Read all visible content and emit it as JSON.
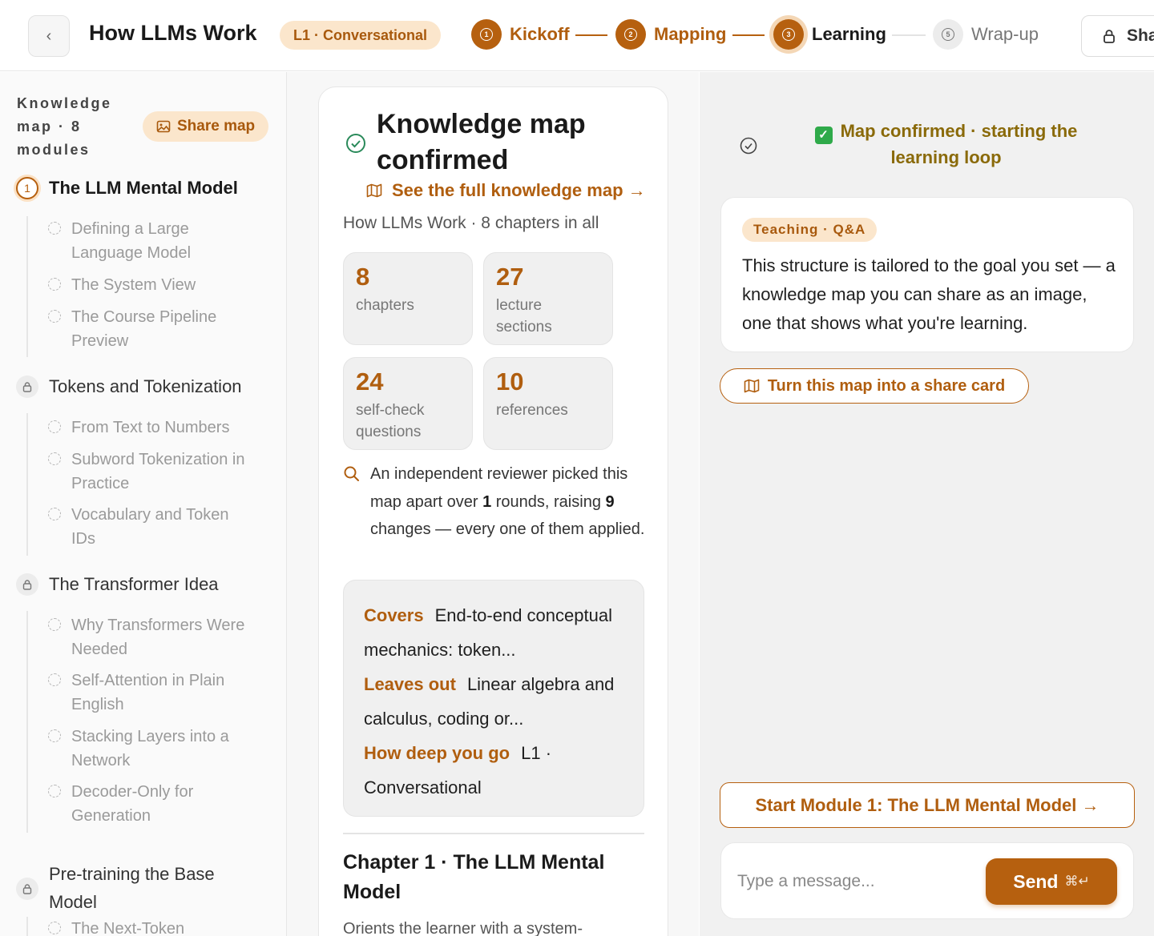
{
  "header": {
    "back_icon": "‹",
    "title": "How LLMs Work",
    "level_badge": "L1 · Conversational",
    "steps": [
      {
        "num": "1",
        "label": "Kickoff",
        "state": "done"
      },
      {
        "num": "2",
        "label": "Mapping",
        "state": "done"
      },
      {
        "num": "3",
        "label": "Learning",
        "state": "active"
      },
      {
        "num": "5",
        "label": "Wrap-up",
        "state": "todo"
      }
    ],
    "share_label": "Sha"
  },
  "sidebar": {
    "title": "Knowledge map · 8 modules",
    "share_map_label": "Share map",
    "modules": [
      {
        "index": "1",
        "label": "The LLM Mental Model",
        "state": "active",
        "lessons": [
          "Defining a Large Language Model",
          "The System View",
          "The Course Pipeline Preview"
        ]
      },
      {
        "index": "",
        "label": "Tokens and Tokenization",
        "state": "locked",
        "lessons": [
          "From Text to Numbers",
          "Subword Tokenization in Practice",
          "Vocabulary and Token IDs"
        ]
      },
      {
        "index": "",
        "label": "The Transformer Idea",
        "state": "locked",
        "lessons": [
          "Why Transformers Were Needed",
          "Self-Attention in Plain English",
          "Stacking Layers into a Network",
          "Decoder-Only for Generation"
        ]
      },
      {
        "index": "",
        "label": "Pre-training the Base Model",
        "state": "locked",
        "lessons": [
          "The Next-Token"
        ]
      }
    ]
  },
  "center": {
    "title": "Knowledge map confirmed",
    "map_link": "See the full knowledge map →",
    "subtitle": "How LLMs Work · 8 chapters in all",
    "stats": [
      {
        "value": "8",
        "label": "chapters"
      },
      {
        "value": "27",
        "label": "lecture sections"
      },
      {
        "value": "24",
        "label": "self-check questions"
      },
      {
        "value": "10",
        "label": "references"
      }
    ],
    "review": {
      "p1": "An independent reviewer picked this map apart over ",
      "rounds": "1",
      "p2": " rounds, raising ",
      "changes": "9",
      "p3": " changes — every one of them applied."
    },
    "covers": {
      "covers_key": "Covers",
      "covers_val": "End-to-end conceptual mechanics: token...",
      "leaves_key": "Leaves out",
      "leaves_val": "Linear algebra and calculus, coding or...",
      "deep_key": "How deep you go",
      "deep_val": "L1 · Conversational"
    },
    "chapter_title": "Chapter 1 · The LLM Mental Model",
    "chapter_desc": "Orients the learner with a system-"
  },
  "right": {
    "status_emoji": "✓",
    "status_text": "Map confirmed · starting the learning loop",
    "message": {
      "tag": "Teaching · Q&A",
      "text": "This structure is tailored to the goal you set — a knowledge map you can share as an image, one that shows what you're learning."
    },
    "share_card_label": "Turn this map into a share card",
    "start_label": "Start Module 1: The LLM Mental Model →",
    "composer": {
      "placeholder": "Type a message...",
      "send_label": "Send",
      "send_shortcut": "⌘↵"
    }
  },
  "colors": {
    "accent": "#b6600f",
    "accent_soft": "#fbe6cc",
    "success": "#2faa4a",
    "status_text": "#8a6a0a"
  },
  "icons": [
    "back-icon",
    "lock-icon",
    "image-icon",
    "map-icon",
    "check-circle-icon",
    "search-icon",
    "green-check-icon"
  ]
}
